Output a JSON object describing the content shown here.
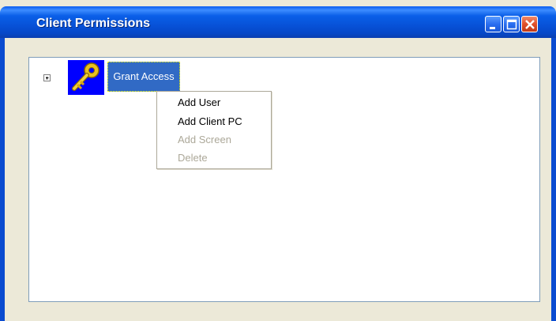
{
  "window": {
    "title": "Client Permissions",
    "controls": {
      "minimize_icon": "minimize-icon",
      "maximize_icon": "maximize-icon",
      "close_icon": "close-icon"
    }
  },
  "tree": {
    "root": {
      "expander_icon": "plus-box-icon",
      "icon": "key-icon",
      "label": "Grant Access",
      "selected": true
    }
  },
  "context_menu": {
    "items": [
      {
        "label": "Add User",
        "enabled": true
      },
      {
        "label": "Add Client PC",
        "enabled": true
      },
      {
        "label": "Add Screen",
        "enabled": false
      },
      {
        "label": "Delete",
        "enabled": false
      }
    ]
  },
  "colors": {
    "titlebar": "#0752d8",
    "selection": "#316ac5",
    "window_bg": "#ece9d8",
    "disabled_text": "#aca899"
  }
}
